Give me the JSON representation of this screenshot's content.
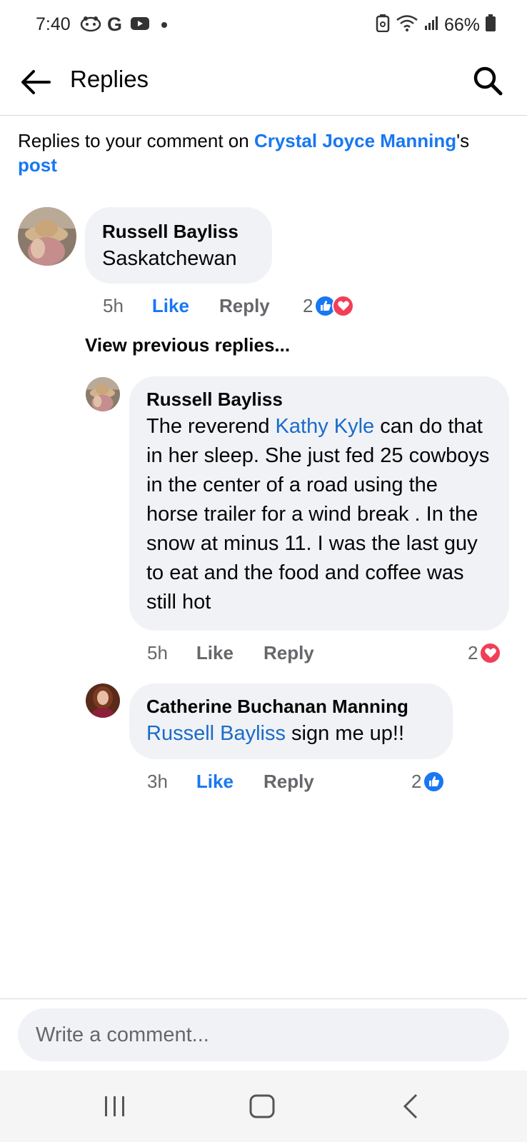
{
  "status_bar": {
    "time": "7:40",
    "battery": "66%",
    "icons": [
      "game-controller-icon",
      "google-icon",
      "youtube-icon",
      "dot-icon",
      "battery-saver-icon",
      "wifi-icon",
      "signal-icon",
      "battery-icon"
    ]
  },
  "header": {
    "title": "Replies",
    "back_icon": "back-arrow-icon",
    "search_icon": "search-icon"
  },
  "context": {
    "prefix": "Replies to your comment on ",
    "author_link": "Crystal Joyce Manning",
    "possessive": "'s",
    "post_link": "post"
  },
  "comments": [
    {
      "author": "Russell Bayliss",
      "text": "Saskatchewan",
      "time": "5h",
      "like_label": "Like",
      "reply_label": "Reply",
      "reaction_count": "2",
      "reactions": [
        "like",
        "love"
      ]
    }
  ],
  "view_previous": "View previous replies...",
  "replies": [
    {
      "author": "Russell Bayliss",
      "text_before": "The reverend ",
      "mention": "Kathy Kyle",
      "text_after": " can do that in her sleep. She just fed 25 cowboys in the center of a road using  the horse trailer for a wind break . In the snow at minus 11. I was the last  guy to eat and the food and coffee was still hot",
      "time": "5h",
      "like_label": "Like",
      "reply_label": "Reply",
      "reaction_count": "2",
      "reactions": [
        "love"
      ]
    },
    {
      "author": "Catherine Buchanan Manning",
      "mention": "Russell Bayliss",
      "text_after": " sign me up!!",
      "time": "3h",
      "like_label": "Like",
      "reply_label": "Reply",
      "reaction_count": "2",
      "reactions": [
        "like"
      ]
    }
  ],
  "composer": {
    "placeholder": "Write a comment..."
  },
  "navbar": {
    "icons": [
      "recent-apps-icon",
      "home-icon",
      "back-icon"
    ]
  },
  "colors": {
    "accent": "#1877f2",
    "mention": "#1b6ac9",
    "bubble": "#f0f2f5",
    "love": "#f33e58",
    "secondary_text": "#65676b"
  }
}
